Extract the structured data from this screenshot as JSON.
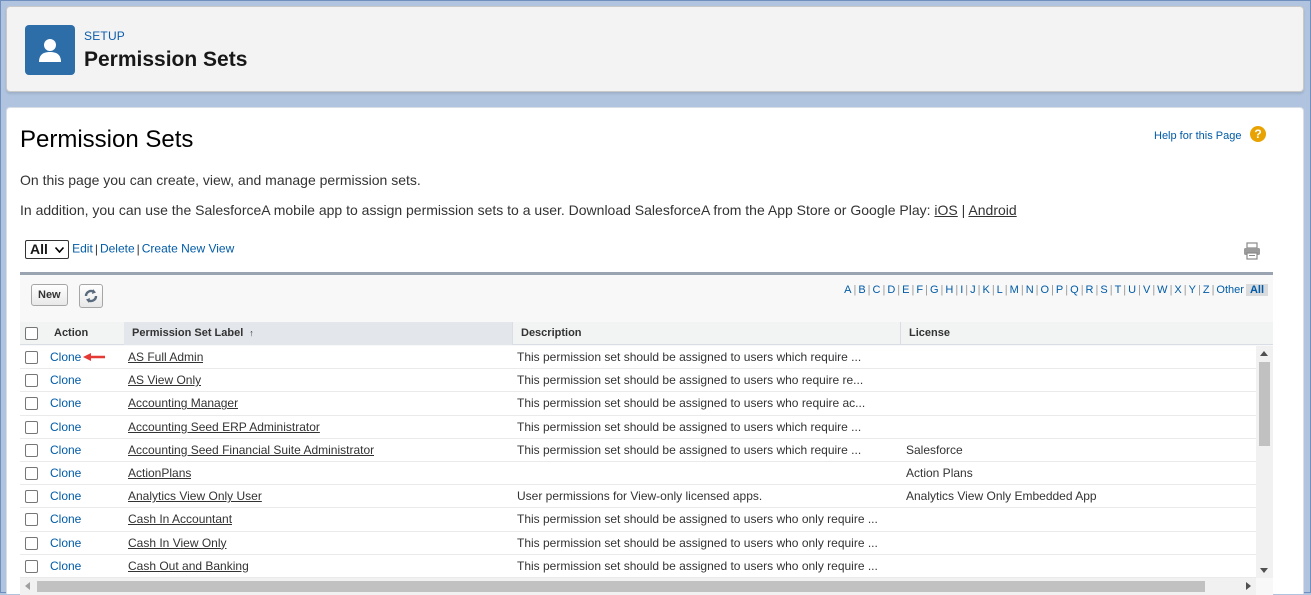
{
  "header": {
    "eyebrow": "SETUP",
    "title": "Permission Sets",
    "icon": "user-icon",
    "accent": "#2d6ea8"
  },
  "page": {
    "title": "Permission Sets",
    "help_label": "Help for this Page",
    "help_glyph": "?",
    "intro_line1": "On this page you can create, view, and manage permission sets.",
    "intro_line2_prefix": "In addition, you can use the SalesforceA mobile app to assign permission sets to a user. Download SalesforceA from the App Store or Google Play:",
    "ios_link": "iOS",
    "link_sep": "|",
    "android_link": "Android"
  },
  "view_bar": {
    "selected_view": "All",
    "edit": "Edit",
    "delete": "Delete",
    "create": "Create New View",
    "sep": "|"
  },
  "toolbar": {
    "new_label": "New"
  },
  "alphabet": [
    "A",
    "B",
    "C",
    "D",
    "E",
    "F",
    "G",
    "H",
    "I",
    "J",
    "K",
    "L",
    "M",
    "N",
    "O",
    "P",
    "Q",
    "R",
    "S",
    "T",
    "U",
    "V",
    "W",
    "X",
    "Y",
    "Z",
    "Other",
    "All"
  ],
  "alphabet_active": "All",
  "columns": {
    "action": "Action",
    "label": "Permission Set Label",
    "label_sort": "↑",
    "description": "Description",
    "license": "License"
  },
  "rows": [
    {
      "action": "Clone",
      "label": "AS Full Admin",
      "description": "This permission set should be assigned to users which require ...",
      "license": ""
    },
    {
      "action": "Clone",
      "label": "AS View Only",
      "description": "This permission set should be assigned to users who require re...",
      "license": ""
    },
    {
      "action": "Clone",
      "label": "Accounting Manager",
      "description": "This permission set should be assigned to users who require ac...",
      "license": ""
    },
    {
      "action": "Clone",
      "label": "Accounting Seed ERP Administrator",
      "description": "This permission set should be assigned to users which require ...",
      "license": ""
    },
    {
      "action": "Clone",
      "label": "Accounting Seed Financial Suite Administrator",
      "description": "This permission set should be assigned to users which require ...",
      "license": "Salesforce"
    },
    {
      "action": "Clone",
      "label": "ActionPlans",
      "description": "",
      "license": "Action Plans"
    },
    {
      "action": "Clone",
      "label": "Analytics View Only User",
      "description": "User permissions for View-only licensed apps.",
      "license": "Analytics View Only Embedded App"
    },
    {
      "action": "Clone",
      "label": "Cash In Accountant",
      "description": "This permission set should be assigned to users who only require ...",
      "license": ""
    },
    {
      "action": "Clone",
      "label": "Cash In View Only",
      "description": "This permission set should be assigned to users who only require ...",
      "license": ""
    },
    {
      "action": "Clone",
      "label": "Cash Out and Banking",
      "description": "This permission set should be assigned to users who only require ...",
      "license": ""
    }
  ]
}
